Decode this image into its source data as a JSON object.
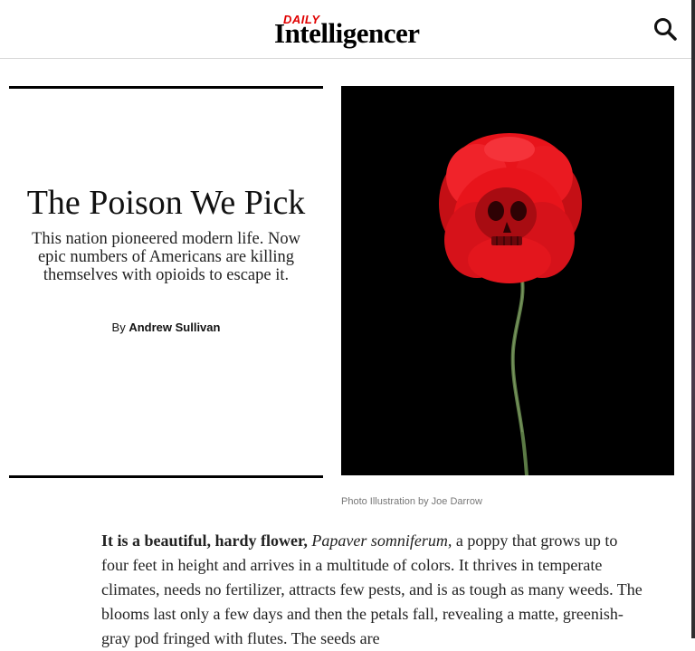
{
  "header": {
    "logo_top": "DAILY",
    "logo_main": "Intelligencer",
    "search_icon": "search-icon"
  },
  "article": {
    "title": "The Poison We Pick",
    "dek": "This nation pioneered modern life. Now epic numbers of Americans are killing themselves with opioids to escape it.",
    "byline_prefix": "By",
    "author": "Andrew Sullivan",
    "photo_caption": "Photo Illustration by Joe Darrow",
    "body_lead_bold": "It is a beautiful, hardy flower,",
    "body_lead_italic": "Papaver somniferum,",
    "body_text": "a poppy that grows up to four feet in height and arrives in a multitude of colors. It thrives in temperate climates, needs no fertilizer, attracts few pests, and is as tough as many weeds. The blooms last only a few days and then the petals fall, revealing a matte, greenish-gray pod fringed with flutes. The seeds are"
  },
  "colors": {
    "logo_red": "#e00000",
    "poppy_red": "#e8141b",
    "stem_green": "#5b7a45"
  }
}
